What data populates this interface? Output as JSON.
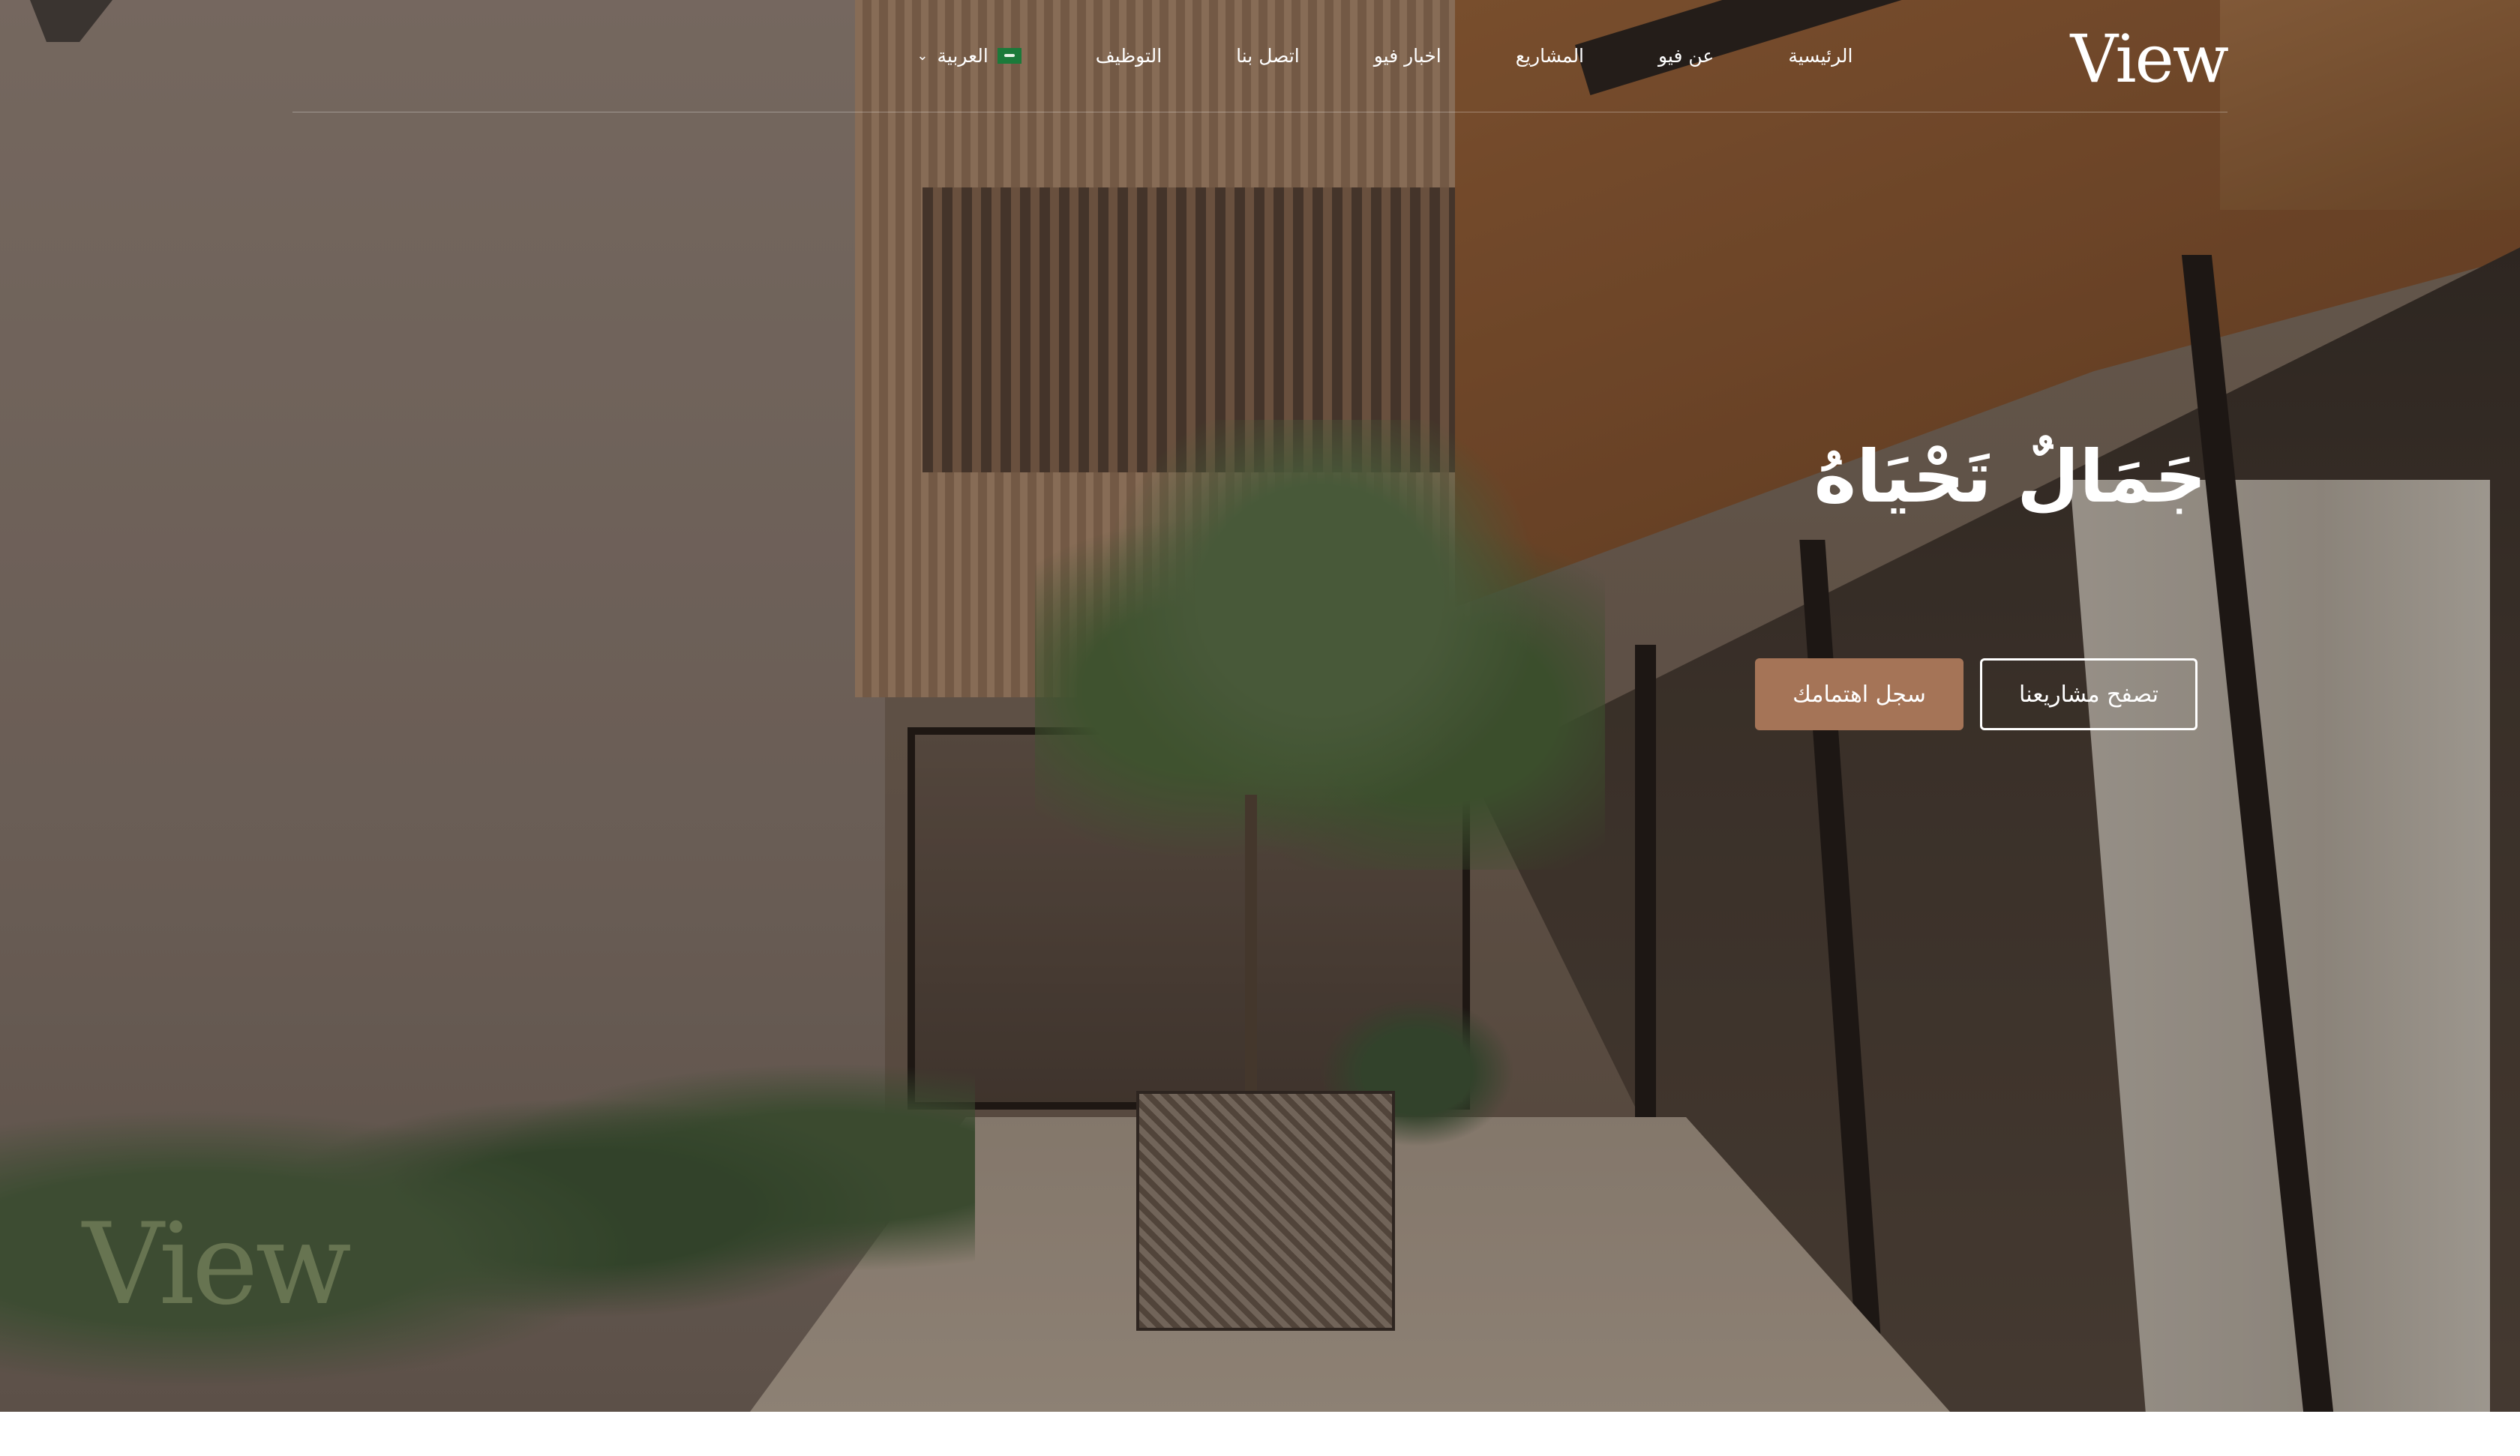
{
  "brand": {
    "logo_text": "View"
  },
  "nav": {
    "items": [
      "الرئيسية",
      "عن فيو",
      "المشاريع",
      "اخبار فيو",
      "اتصل بنا",
      "التوظيف"
    ],
    "language": {
      "label": "العربية",
      "flag": "saudi-flag-icon",
      "chevron": "⌄"
    }
  },
  "hero": {
    "headline": "جَمَالٌ تَحْيَاهُ",
    "primary_cta": "تصفح مشاريعنا",
    "secondary_cta": "سجل اهتمامك",
    "watermark": "View"
  },
  "colors": {
    "accent": "#a57457",
    "text": "#ffffff"
  }
}
